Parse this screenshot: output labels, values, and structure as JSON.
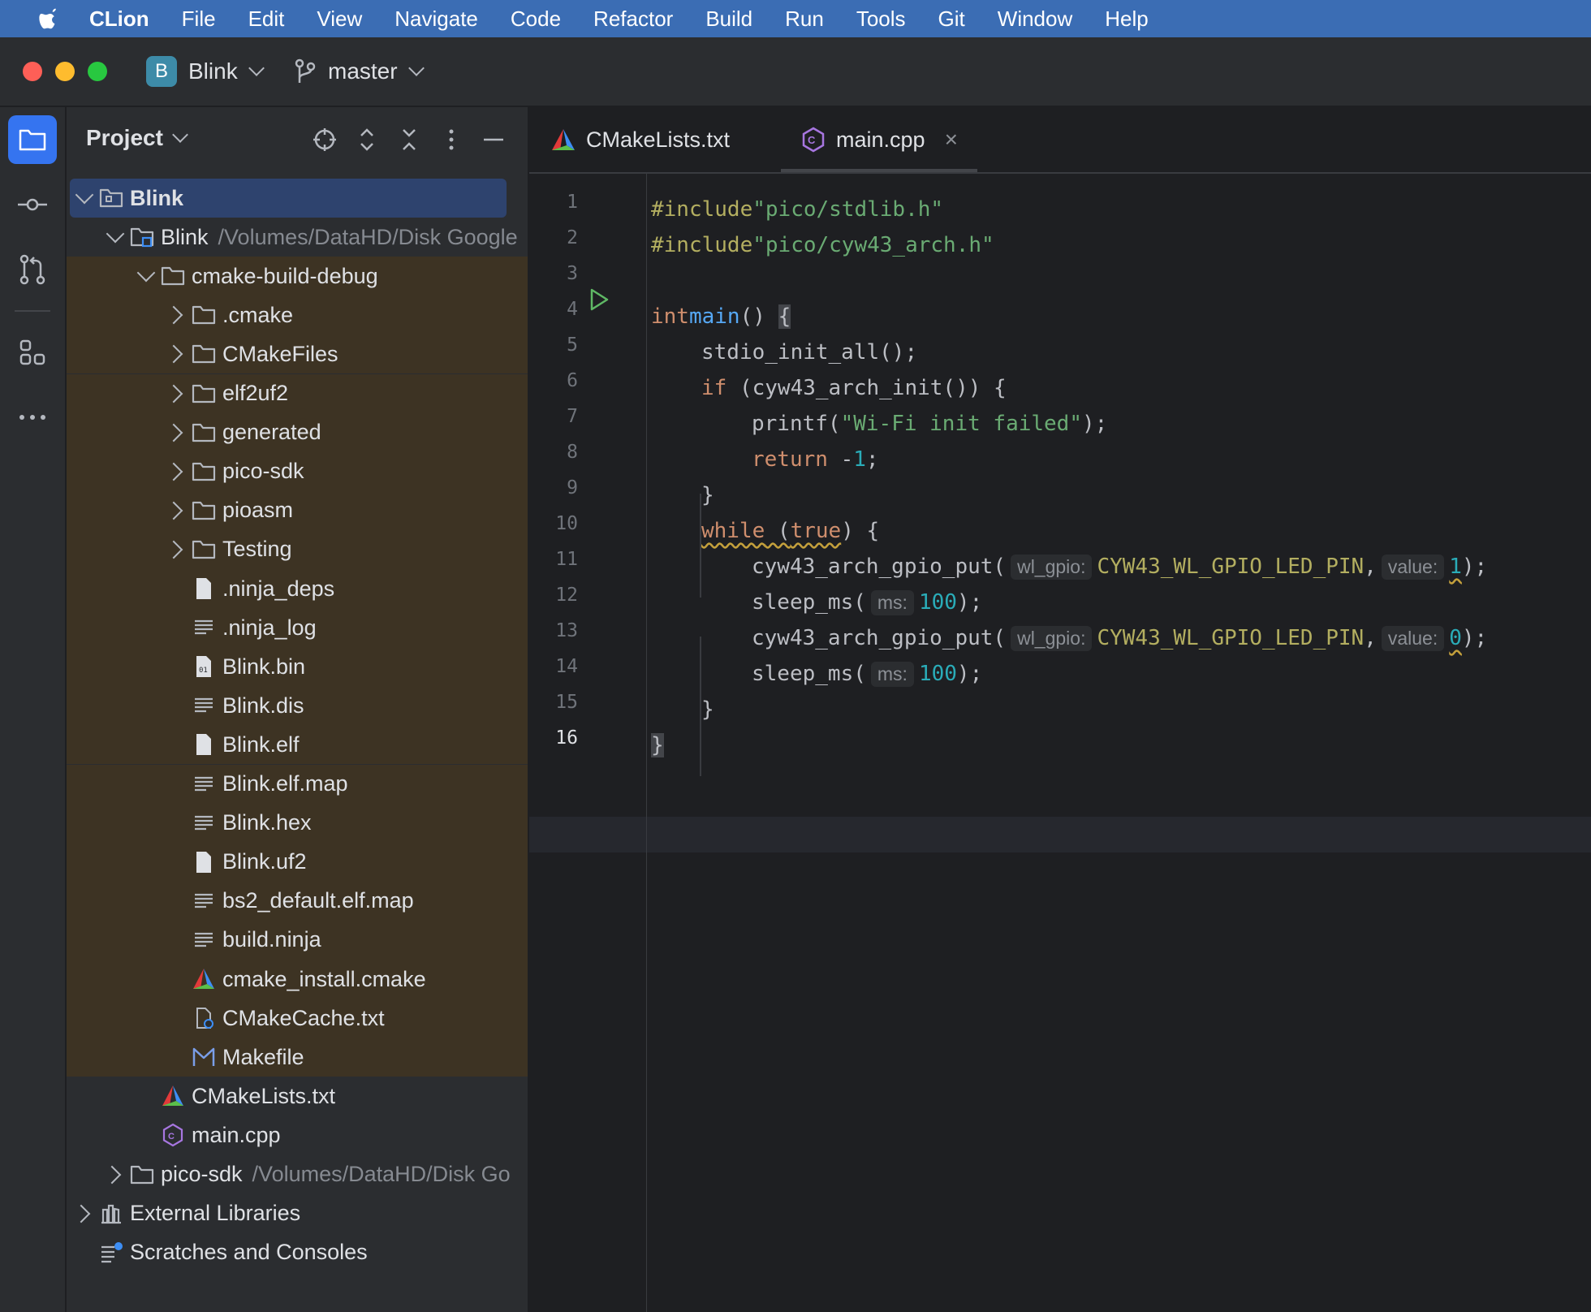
{
  "menubar": {
    "app": "CLion",
    "items": [
      "File",
      "Edit",
      "View",
      "Navigate",
      "Code",
      "Refactor",
      "Build",
      "Run",
      "Tools",
      "Git",
      "Window",
      "Help"
    ]
  },
  "titlebar": {
    "project_badge": "B",
    "project_name": "Blink",
    "branch": "master"
  },
  "panel": {
    "title": "Project",
    "tree": [
      {
        "label": "Blink",
        "path": "",
        "depth": 0,
        "arrow": "down",
        "icon": "module-folder-icon",
        "selected": true
      },
      {
        "label": "Blink",
        "path": "/Volumes/DataHD/Disk Google",
        "depth": 1,
        "arrow": "down",
        "icon": "project-folder-icon"
      },
      {
        "label": "cmake-build-debug",
        "path": "",
        "depth": 2,
        "arrow": "down",
        "icon": "folder-icon",
        "excluded": true
      },
      {
        "label": ".cmake",
        "path": "",
        "depth": 3,
        "arrow": "right",
        "icon": "folder-icon",
        "excluded": true
      },
      {
        "label": "CMakeFiles",
        "path": "",
        "depth": 3,
        "arrow": "right",
        "icon": "folder-icon",
        "excluded": true
      },
      {
        "label": "elf2uf2",
        "path": "",
        "depth": 3,
        "arrow": "right",
        "icon": "folder-icon",
        "excluded": true
      },
      {
        "label": "generated",
        "path": "",
        "depth": 3,
        "arrow": "right",
        "icon": "folder-icon",
        "excluded": true
      },
      {
        "label": "pico-sdk",
        "path": "",
        "depth": 3,
        "arrow": "right",
        "icon": "folder-icon",
        "excluded": true
      },
      {
        "label": "pioasm",
        "path": "",
        "depth": 3,
        "arrow": "right",
        "icon": "folder-icon",
        "excluded": true
      },
      {
        "label": "Testing",
        "path": "",
        "depth": 3,
        "arrow": "right",
        "icon": "folder-icon",
        "excluded": true
      },
      {
        "label": ".ninja_deps",
        "path": "",
        "depth": 3,
        "arrow": "none",
        "icon": "file-icon",
        "excluded": true
      },
      {
        "label": ".ninja_log",
        "path": "",
        "depth": 3,
        "arrow": "none",
        "icon": "text-file-icon",
        "excluded": true
      },
      {
        "label": "Blink.bin",
        "path": "",
        "depth": 3,
        "arrow": "none",
        "icon": "binary-file-icon",
        "excluded": true
      },
      {
        "label": "Blink.dis",
        "path": "",
        "depth": 3,
        "arrow": "none",
        "icon": "text-file-icon",
        "excluded": true
      },
      {
        "label": "Blink.elf",
        "path": "",
        "depth": 3,
        "arrow": "none",
        "icon": "file-icon",
        "excluded": true
      },
      {
        "label": "Blink.elf.map",
        "path": "",
        "depth": 3,
        "arrow": "none",
        "icon": "text-file-icon",
        "excluded": true
      },
      {
        "label": "Blink.hex",
        "path": "",
        "depth": 3,
        "arrow": "none",
        "icon": "text-file-icon",
        "excluded": true
      },
      {
        "label": "Blink.uf2",
        "path": "",
        "depth": 3,
        "arrow": "none",
        "icon": "file-icon",
        "excluded": true
      },
      {
        "label": "bs2_default.elf.map",
        "path": "",
        "depth": 3,
        "arrow": "none",
        "icon": "text-file-icon",
        "excluded": true
      },
      {
        "label": "build.ninja",
        "path": "",
        "depth": 3,
        "arrow": "none",
        "icon": "text-file-icon",
        "excluded": true
      },
      {
        "label": "cmake_install.cmake",
        "path": "",
        "depth": 3,
        "arrow": "none",
        "icon": "cmake-icon",
        "excluded": true
      },
      {
        "label": "CMakeCache.txt",
        "path": "",
        "depth": 3,
        "arrow": "none",
        "icon": "cmake-cache-icon",
        "excluded": true
      },
      {
        "label": "Makefile",
        "path": "",
        "depth": 3,
        "arrow": "none",
        "icon": "makefile-icon",
        "excluded": true
      },
      {
        "label": "CMakeLists.txt",
        "path": "",
        "depth": 2,
        "arrow": "none",
        "icon": "cmake-icon"
      },
      {
        "label": "main.cpp",
        "path": "",
        "depth": 2,
        "arrow": "none",
        "icon": "cpp-file-icon"
      },
      {
        "label": "pico-sdk",
        "path": "/Volumes/DataHD/Disk Go",
        "depth": 1,
        "arrow": "right",
        "icon": "folder-icon"
      },
      {
        "label": "External Libraries",
        "path": "",
        "depth": 0,
        "arrow": "right",
        "icon": "library-icon"
      },
      {
        "label": "Scratches and Consoles",
        "path": "",
        "depth": 0,
        "arrow": "none",
        "icon": "scratches-icon"
      }
    ]
  },
  "editor": {
    "tabs": [
      {
        "label": "CMakeLists.txt",
        "icon": "cmake-icon",
        "active": false
      },
      {
        "label": "main.cpp",
        "icon": "cpp-file-icon",
        "active": true,
        "close": "×"
      }
    ],
    "line_numbers": [
      "1",
      "2",
      "3",
      "4",
      "5",
      "6",
      "7",
      "8",
      "9",
      "10",
      "11",
      "12",
      "13",
      "14",
      "15",
      "16"
    ],
    "current_line": 16,
    "hints": {
      "wl_gpio": "wl_gpio:",
      "value": "value:",
      "ms": "ms:"
    },
    "code": {
      "l1_directive": "#include",
      "l1_path": "\"pico/stdlib.h\"",
      "l2_directive": "#include",
      "l2_path": "\"pico/cyw43_arch.h\"",
      "l4_type": "int",
      "l4_fn": "main",
      "l4_rest": "() ",
      "l4_brace": "{",
      "l5": "stdio_init_all();",
      "l6_kw": "if",
      "l6_rest": " (cyw43_arch_init()) {",
      "l7_fn": "printf(",
      "l7_str": "\"Wi-Fi init failed\"",
      "l7_end": ");",
      "l8_kw": "return",
      "l8_minus": " -",
      "l8_num": "1",
      "l8_end": ";",
      "l9": "}",
      "l10_kw": "while",
      "l10_open": " (",
      "l10_val": "true",
      "l10_rest": ") {",
      "l11_fn": "cyw43_arch_gpio_put(",
      "l11_mac": "CYW43_WL_GPIO_LED_PIN",
      "l11_comma": ",",
      "l11_num": "1",
      "l11_end": ");",
      "l12_fn": "sleep_ms(",
      "l12_num": "100",
      "l12_end": ");",
      "l13_fn": "cyw43_arch_gpio_put(",
      "l13_mac": "CYW43_WL_GPIO_LED_PIN",
      "l13_comma": ",",
      "l13_num": "0",
      "l13_end": ");",
      "l14_fn": "sleep_ms(",
      "l14_num": "100",
      "l14_end": ");",
      "l15": "}",
      "l16": "}"
    }
  },
  "colors": {
    "menubar": "#3b6db4",
    "excluded_folder_bg": "#3d3323",
    "selection": "#2e436e",
    "active_tab_underline": "#3574f0"
  }
}
